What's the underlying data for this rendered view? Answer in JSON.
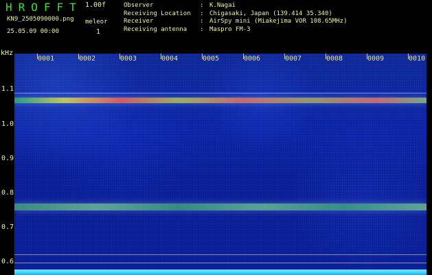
{
  "header": {
    "app_title": "HROFFT",
    "version": "1.00f",
    "file_name": "KN9_2505090000.png",
    "datetime": "25.05.09 00:00",
    "meleor_label": "meleor",
    "meleor_count": "1"
  },
  "info": {
    "observer_label": "Observer",
    "observer_value": "K.Nagai",
    "location_label": "Receiving Location",
    "location_value": "Chigasaki, Japan (139.414 35.340)",
    "receiver_label": "Receiver",
    "receiver_value": "AirSpy mini (Miakejima VOR 108.65MHz)",
    "antenna_label": "Receiving antenna",
    "antenna_value": "Maspro FM-3",
    "separator": ":"
  },
  "axes": {
    "unit": "kHz",
    "y_ticks": [
      "1.1",
      "1.0",
      "0.9",
      "0.8",
      "0.7",
      "0.6"
    ],
    "x_ticks": [
      "0001",
      "0002",
      "0003",
      "0004",
      "0005",
      "0006",
      "0007",
      "0008",
      "0009",
      "0010"
    ]
  }
}
